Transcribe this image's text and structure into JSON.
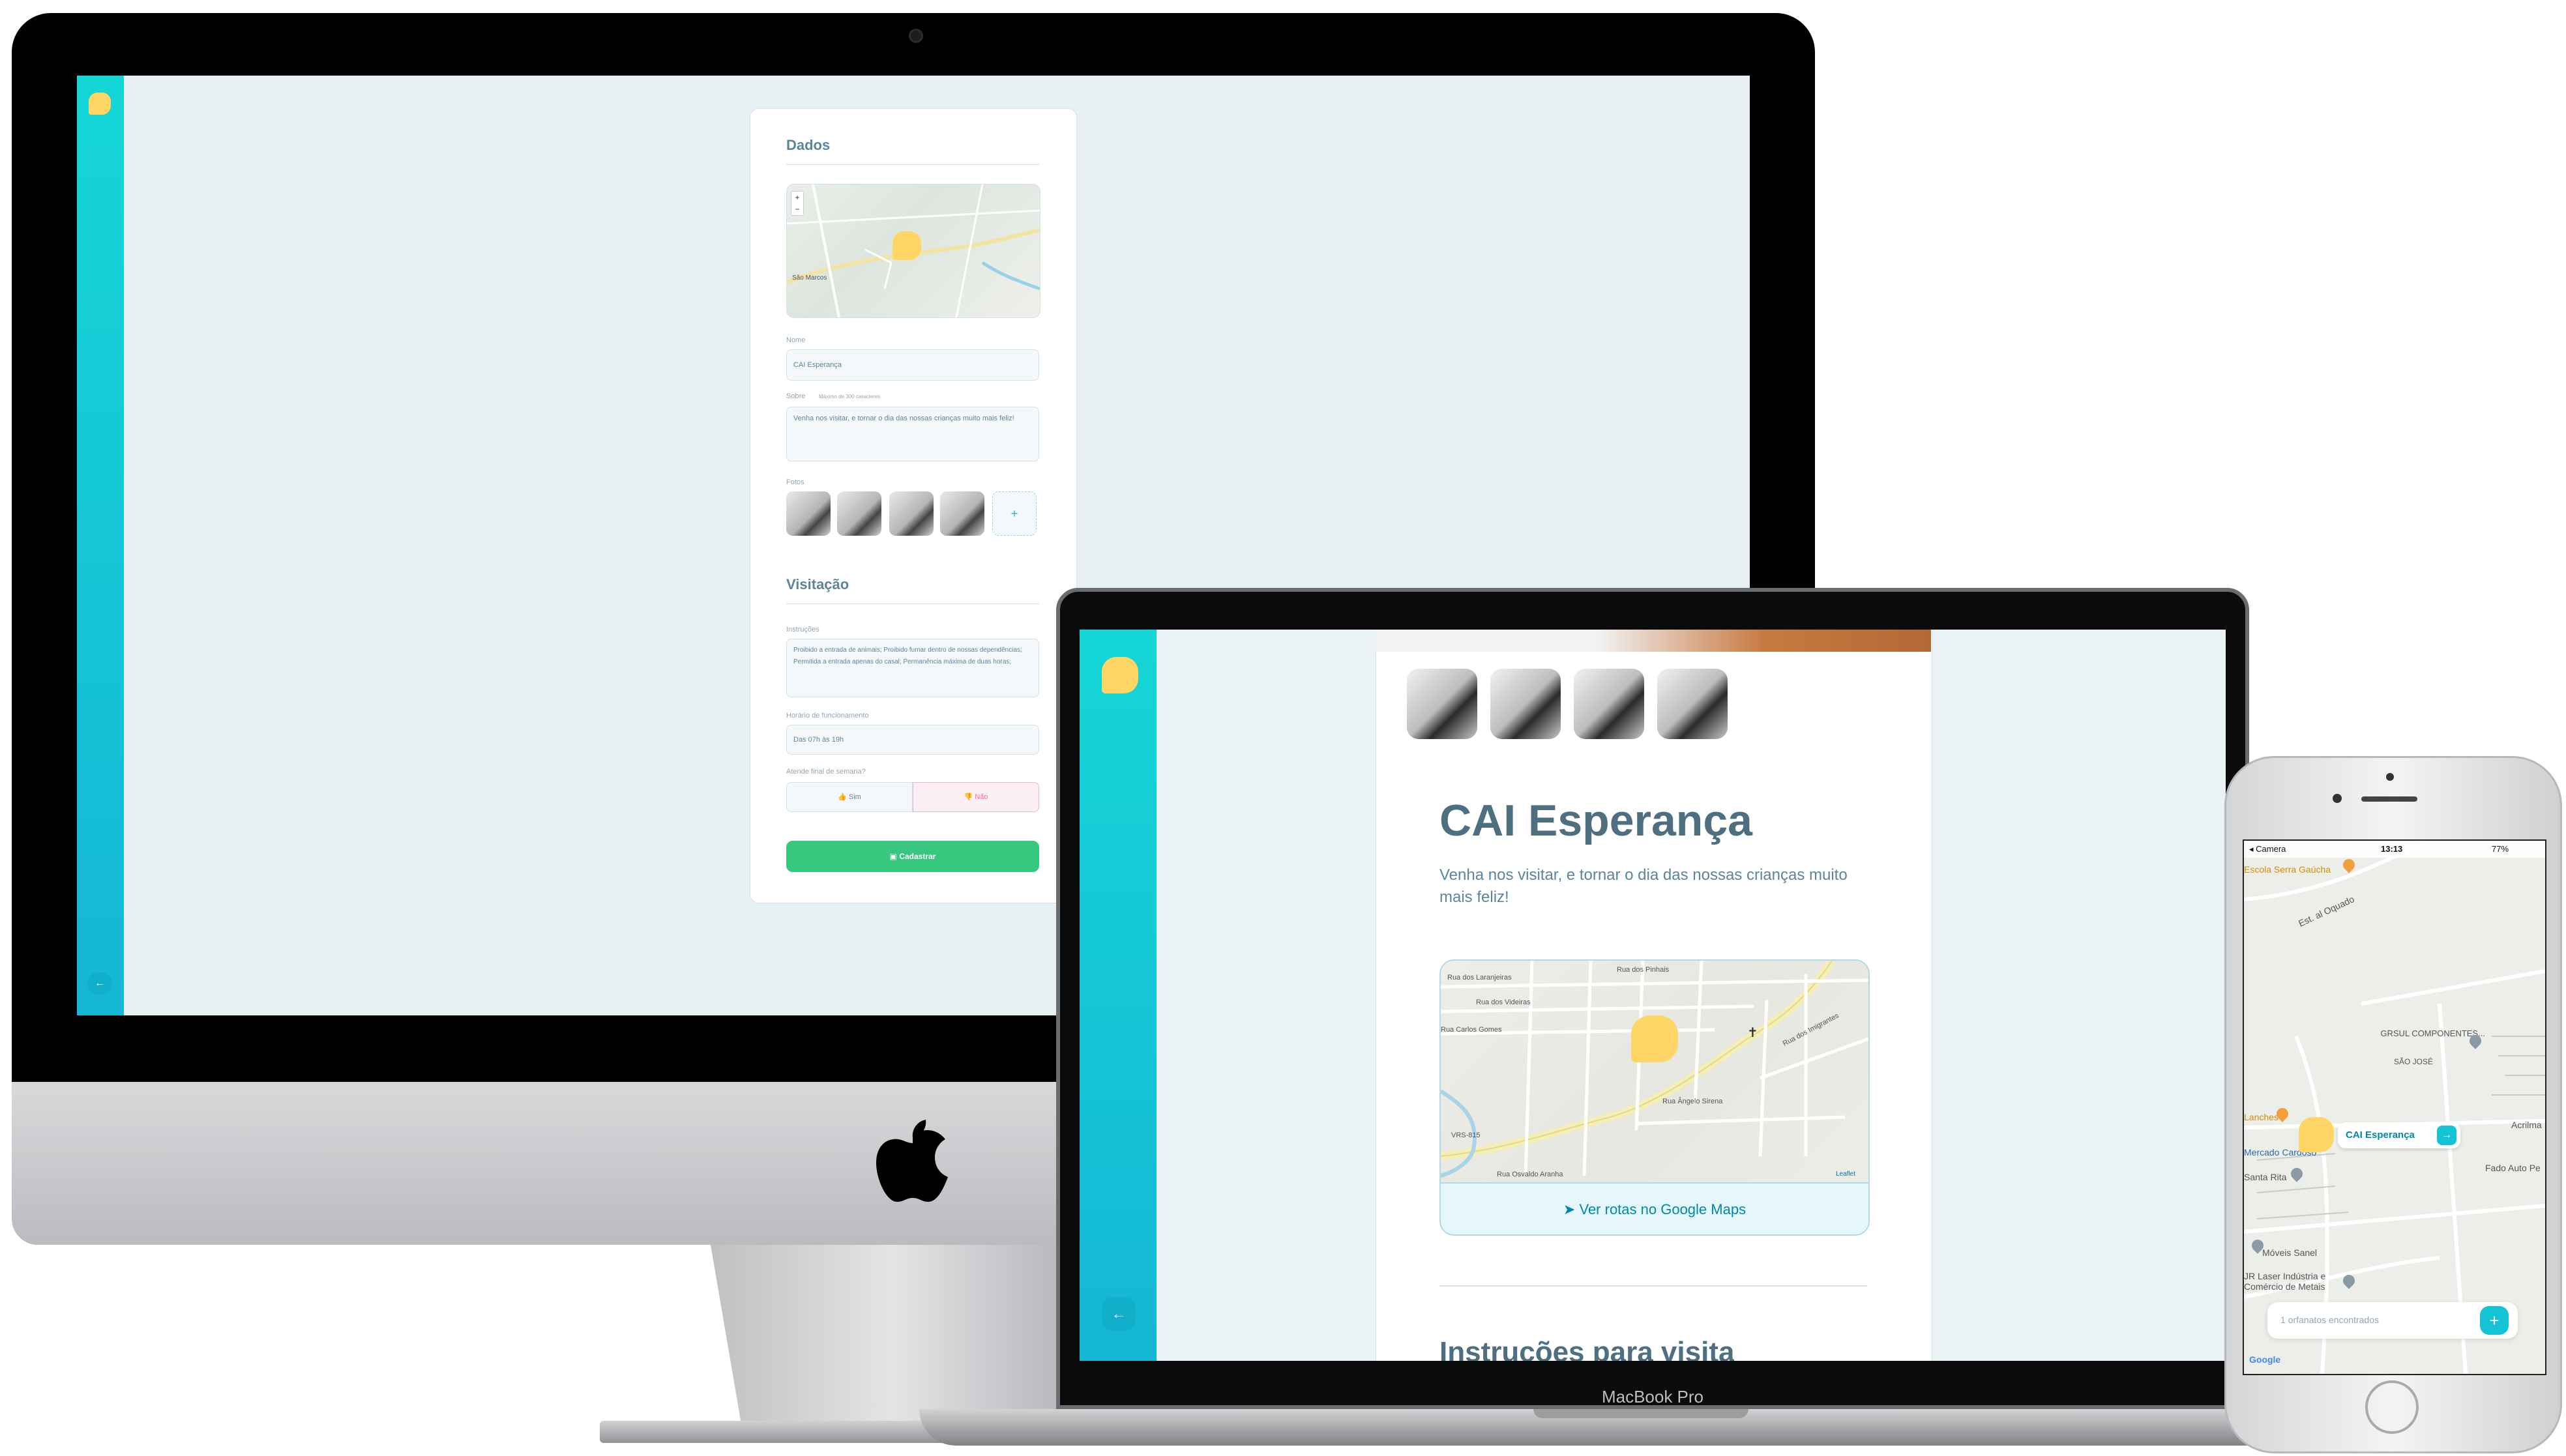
{
  "colors": {
    "accent": "#15c3d6",
    "brand_yellow": "#ffd666",
    "title_text": "#4d6f80",
    "confirm_green": "#37c77f",
    "deny_red": "#ff669d"
  },
  "dashboard": {
    "section_data": "Dados",
    "map_zoom_in": "+",
    "map_zoom_out": "−",
    "map_label": "São Marcos",
    "name_label": "Nome",
    "name_value": "CAI Esperança",
    "about_label": "Sobre",
    "about_hint": "Máximo de 300 caracteres",
    "about_value": "Venha nos visitar, e tornar o dia das nossas crianças muito mais feliz!",
    "photos_label": "Fotos",
    "add_photo": "+",
    "section_visit": "Visitação",
    "instructions_label": "Instruções",
    "instructions_value": "Proibido a entrada de animais; Proibido fumar dentro de nossas dependências; Permitida a entrada apenas do casal; Permanência máxima de duas horas;",
    "hours_label": "Horário de funcionamento",
    "hours_value": "Das 07h às 19h",
    "weekend_label": "Atende final de semana?",
    "yes_label": "Sim",
    "no_label": "Não",
    "submit_label": "Cadastrar",
    "back_icon": "arrow-left-icon"
  },
  "laptop": {
    "title": "CAI Esperança",
    "description": "Venha nos visitar, e tornar o dia das nossas crianças muito mais feliz!",
    "streets": [
      "Rua dos Laranjeiras",
      "Rua dos Pinhais",
      "Rua dos Videiras",
      "Rua Carlos Gomes",
      "Rua Ângelo Sirena",
      "VRS-815",
      "Rua Osvaldo Aranha",
      "Rua dos Imigrantes"
    ],
    "map_attribution": "Leaflet",
    "maps_link": "Ver rotas no Google Maps",
    "instructions_title": "Instruções para visita",
    "device_label": "MacBook Pro"
  },
  "phone": {
    "status_carrier": "◂ Camera",
    "status_time": "13:13",
    "status_battery": "77%",
    "places": [
      "Escola Serra Gaúcha",
      "Est. al Oquado",
      "SÃO JOSÉ",
      "GRSUL COMPONENTES...",
      "Lanches",
      "Mercado Cardoso",
      "Santa Rita",
      "Acrilma",
      "Fado Auto Pe",
      "Móveis Sanel",
      "JR Laser Indústria e Comércio de Metais"
    ],
    "pin_label": "CAI Esperança",
    "found_text": "1 orfanatos encontrados",
    "add_button": "+",
    "google_logo": "Google"
  }
}
